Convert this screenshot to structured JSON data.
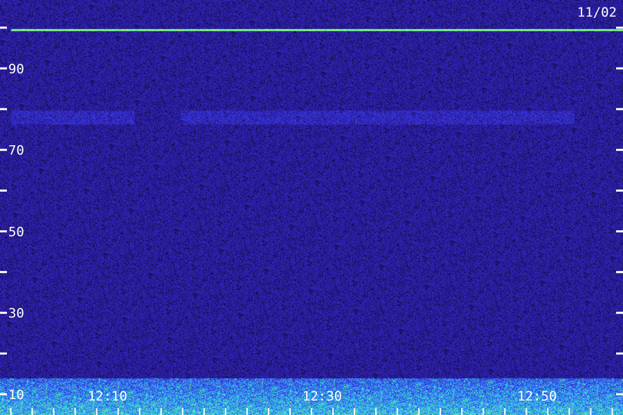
{
  "chart_data": {
    "type": "heatmap",
    "title": "",
    "date": "11/02",
    "xlabel": "",
    "ylabel": "",
    "y_axis": {
      "range": [
        0,
        100
      ],
      "tick_labels": [
        "10",
        "30",
        "50",
        "70",
        "90"
      ],
      "tick_values": [
        10,
        20,
        30,
        40,
        50,
        60,
        70,
        80,
        90,
        100
      ]
    },
    "x_axis": {
      "range": [
        "12:00",
        "12:58"
      ],
      "tick_labels": [
        "12:10",
        "12:30",
        "12:50"
      ]
    },
    "colormap": [
      "#000000",
      "#1a0d5a",
      "#2a1d9a",
      "#3a2fe0",
      "#2f8cff",
      "#33e8d8",
      "#9aff5a",
      "#ffff66"
    ],
    "features": [
      {
        "name": "steady carrier",
        "frequency": 99.5,
        "intensity": "high"
      },
      {
        "name": "intermittent band",
        "frequency": 78,
        "intensity": "medium"
      },
      {
        "name": "broadband noise floor",
        "frequency_range": [
          0,
          14
        ],
        "intensity": "high"
      }
    ]
  }
}
